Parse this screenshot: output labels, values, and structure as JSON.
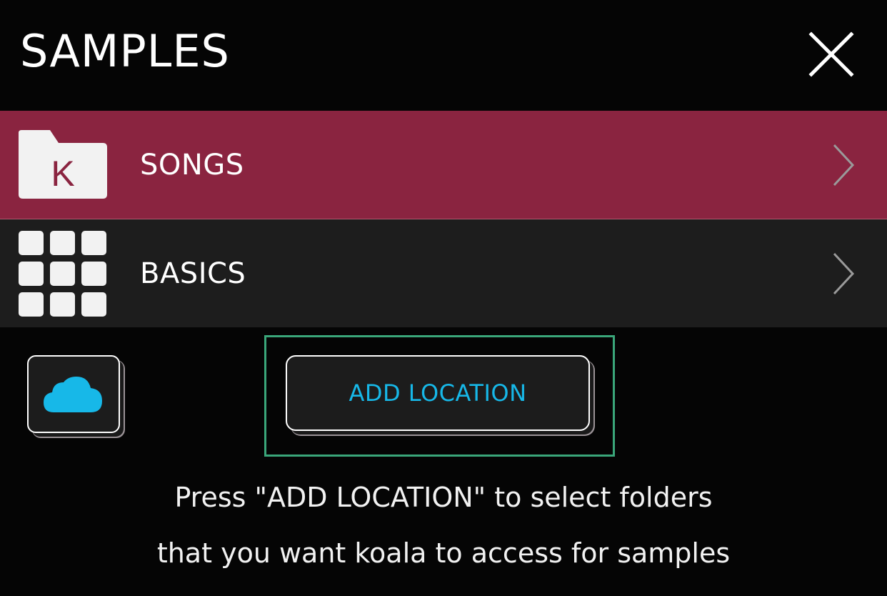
{
  "header": {
    "title": "SAMPLES",
    "close_icon": "close-icon"
  },
  "rows": [
    {
      "label": "SONGS",
      "icon": "koala-folder-icon",
      "icon_letter": "K",
      "chevron": "chevron-right-icon",
      "selected": true
    },
    {
      "label": "BASICS",
      "icon": "grid-icon",
      "chevron": "chevron-right-icon",
      "selected": false
    }
  ],
  "actions": {
    "cloud_icon": "cloud-icon",
    "add_location_label": "ADD LOCATION"
  },
  "hint": {
    "line1": "Press \"ADD LOCATION\" to select folders",
    "line2": "that you want koala to access for samples"
  },
  "colors": {
    "selected_row": "#8a2440",
    "row_bg": "#1d1d1d",
    "accent": "#17b8e8",
    "highlight": "#3aa67a"
  }
}
